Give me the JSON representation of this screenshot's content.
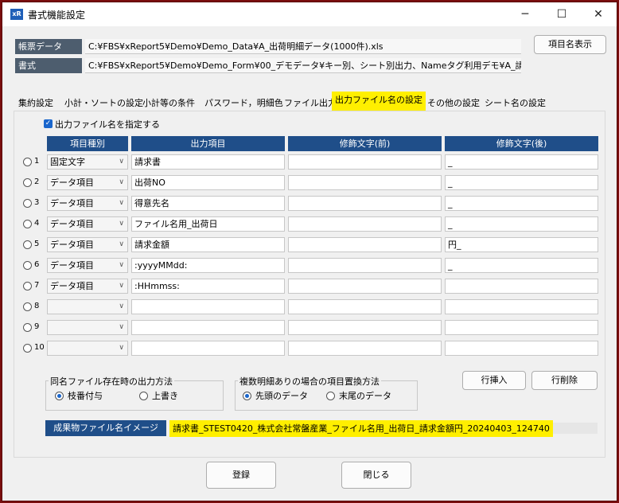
{
  "window": {
    "title": "書式機能設定",
    "minimize": "─",
    "maximize": "☐",
    "close": "✕",
    "icon_text": "xR"
  },
  "header": {
    "data_label": "帳票データ",
    "data_value": "C:¥FBS¥xReport5¥Demo¥Demo_Data¥A_出荷明細データ(1000件).xls",
    "format_label": "書式",
    "format_value": "C:¥FBS¥xReport5¥Demo¥Demo_Form¥00_デモデータ¥キー別、シート別出力、Nameタグ利用デモ¥A_請求書",
    "show_names_button": "項目名表示"
  },
  "tabs": [
    "集約設定",
    "小計・ソートの設定",
    "小計等の条件",
    "パスワード，明細色",
    "ファイル出力",
    "出力ファイル名の設定",
    "その他の設定",
    "シート名の設定"
  ],
  "specify": {
    "label": "出力ファイル名を指定する",
    "checked": true
  },
  "columns": [
    "項目種別",
    "出力項目",
    "修飾文字(前)",
    "修飾文字(後)"
  ],
  "rows": [
    {
      "num": "1",
      "type": "固定文字",
      "item": "請求書",
      "prefix": "",
      "suffix": "_"
    },
    {
      "num": "2",
      "type": "データ項目",
      "item": "出荷NO",
      "prefix": "",
      "suffix": "_"
    },
    {
      "num": "3",
      "type": "データ項目",
      "item": "得意先名",
      "prefix": "",
      "suffix": "_"
    },
    {
      "num": "4",
      "type": "データ項目",
      "item": "ファイル名用_出荷日",
      "prefix": "",
      "suffix": "_"
    },
    {
      "num": "5",
      "type": "データ項目",
      "item": "請求金額",
      "prefix": "",
      "suffix": "円_"
    },
    {
      "num": "6",
      "type": "データ項目",
      "item": ":yyyyMMdd:",
      "prefix": "",
      "suffix": "_"
    },
    {
      "num": "7",
      "type": "データ項目",
      "item": ":HHmmss:",
      "prefix": "",
      "suffix": ""
    },
    {
      "num": "8",
      "type": "",
      "item": "",
      "prefix": "",
      "suffix": ""
    },
    {
      "num": "9",
      "type": "",
      "item": "",
      "prefix": "",
      "suffix": ""
    },
    {
      "num": "10",
      "type": "",
      "item": "",
      "prefix": "",
      "suffix": ""
    }
  ],
  "same_file": {
    "label": "同名ファイル存在時の出力方法",
    "option1": "枝番付与",
    "option2": "上書き",
    "selected": 1
  },
  "multi_detail": {
    "label": "複数明細ありの場合の項目置換方法",
    "option1": "先頭のデータ",
    "option2": "末尾のデータ",
    "selected": 1
  },
  "row_insert_button": "行挿入",
  "row_delete_button": "行削除",
  "result": {
    "label": "成果物ファイル名イメージ",
    "value": "請求書_STEST0420_株式会社常盤産業_ファイル名用_出荷日_請求金額円_20240403_124740"
  },
  "footer": {
    "register_button": "登録",
    "close_button": "閉じる"
  },
  "colors": {
    "accent": "#1f4e89",
    "highlight": "#ffef00",
    "frame": "#7a0e0e"
  }
}
